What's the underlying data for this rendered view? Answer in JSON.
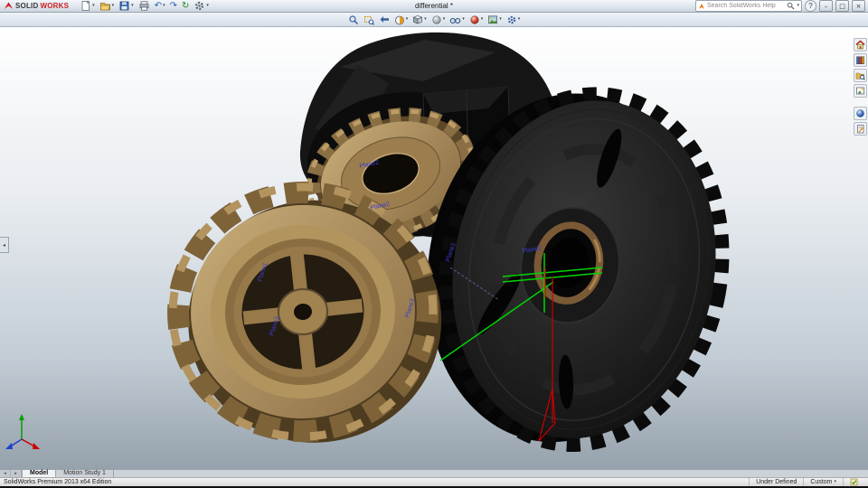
{
  "titlebar": {
    "brand": {
      "solid": "SOLID",
      "works": "WORKS"
    },
    "document_title": "differential *",
    "search": {
      "placeholder": "Search SolidWorks Help"
    },
    "help_glyph": "?",
    "caret": "▾",
    "window_buttons": {
      "minimize": "–",
      "restore": "□",
      "close": "×"
    },
    "glyphs": {
      "undo": "↶",
      "redo": "↷",
      "rebuild": "↻"
    }
  },
  "main_toolbar": {
    "items": [
      "new",
      "open",
      "save",
      "print",
      "undo",
      "redo",
      "rebuild",
      "options"
    ]
  },
  "view_toolbar": {
    "items": [
      "zoom-to-fit",
      "zoom-to-area",
      "previous-view",
      "section-view",
      "view-orientation",
      "display-style",
      "hide-show-items",
      "edit-appearance",
      "apply-scene",
      "view-settings"
    ]
  },
  "task_pane": {
    "items": [
      "solidworks-resources",
      "design-library",
      "file-explorer",
      "view-palette",
      "appearances-scenes",
      "custom-properties"
    ]
  },
  "viewport": {
    "panel_tab_glyph": "◂",
    "plane_labels": [
      "Plane2",
      "Plane2",
      "Plane1",
      "Plane3",
      "Plane1",
      "Plane3",
      "Plane2"
    ],
    "colors": {
      "gear_gold": "#a98c5c",
      "housing": "#161616",
      "sketch_green": "#00d400",
      "sketch_red": "#cc0000",
      "plane_label": "#3c3ccc"
    }
  },
  "tabs": {
    "nav_left": "◂",
    "nav_right": "▸",
    "model": "Model",
    "motion_study": "Motion Study 1"
  },
  "statusbar": {
    "edition": "SolidWorks Premium 2013 x64 Edition",
    "constraint_state": "Under Defined",
    "configuration": "Custom"
  }
}
